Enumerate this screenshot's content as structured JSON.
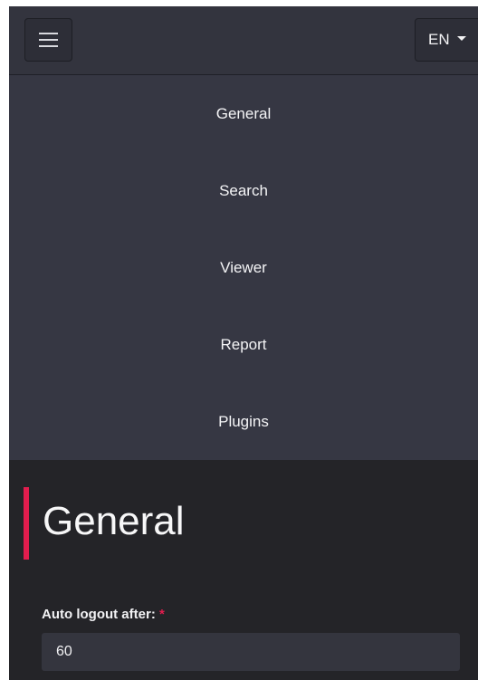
{
  "navbar": {
    "menu_icon": "hamburger-menu-icon",
    "language": "EN",
    "language_icon": "caret-down-icon"
  },
  "menu": {
    "items": [
      {
        "label": "General"
      },
      {
        "label": "Search"
      },
      {
        "label": "Viewer"
      },
      {
        "label": "Report"
      },
      {
        "label": "Plugins"
      }
    ]
  },
  "main": {
    "title": "General",
    "fields": [
      {
        "label": "Auto logout after:",
        "required_marker": "*",
        "value": "60"
      }
    ]
  },
  "colors": {
    "navbar_bg": "#33343e",
    "menu_bg": "#363743",
    "content_bg": "#242428",
    "accent": "#e21d4e",
    "input_bg": "#34353e"
  }
}
